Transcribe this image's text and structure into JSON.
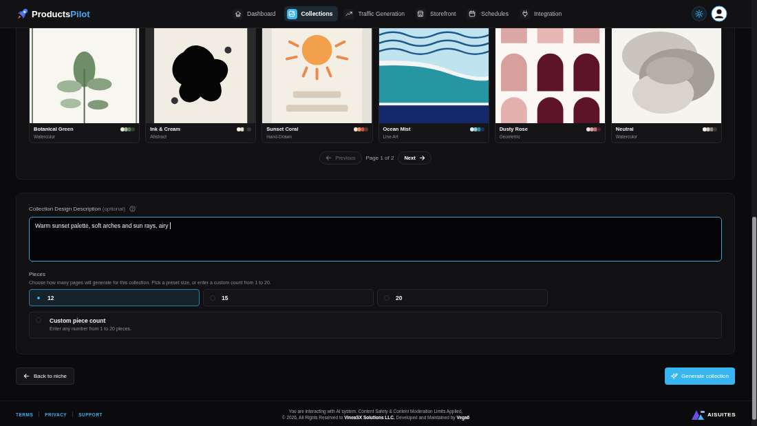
{
  "header": {
    "brand": {
      "name": "Products",
      "accent": "Pilot"
    },
    "nav": [
      {
        "label": "Dashboard",
        "selected": false
      },
      {
        "label": "Collections",
        "selected": true
      },
      {
        "label": "Traffic Generation",
        "selected": false
      },
      {
        "label": "Storefront",
        "selected": false
      },
      {
        "label": "Schedules",
        "selected": false
      },
      {
        "label": "Integration",
        "selected": false
      }
    ]
  },
  "styles": [
    {
      "name": "Botanical Green",
      "type": "Watercolor",
      "swatches": [
        {
          "color": "#e6ece3"
        },
        {
          "color": "#9db596"
        },
        {
          "color": "#5a7a54"
        },
        {
          "color": "#2f4430"
        }
      ]
    },
    {
      "name": "Ink & Cream",
      "type": "Abstract",
      "swatches": [
        {
          "color": "#f3efe4"
        },
        {
          "color": "#e2ddd0"
        },
        {
          "color": "#1c1c1c"
        },
        {
          "color": "#3a3a3a"
        }
      ]
    },
    {
      "name": "Sunset Coral",
      "type": "Hand-Drawn",
      "swatches": [
        {
          "color": "#f6e6d8"
        },
        {
          "color": "#f0905f"
        },
        {
          "color": "#c9553b"
        },
        {
          "color": "#5b3a2b"
        }
      ]
    },
    {
      "name": "Ocean Mist",
      "type": "Line Art",
      "swatches": [
        {
          "color": "#d6ecf0"
        },
        {
          "color": "#8cc6d0"
        },
        {
          "color": "#2b8fa0"
        },
        {
          "color": "#1d2f5c"
        }
      ]
    },
    {
      "name": "Dusty Rose",
      "type": "Geometric",
      "swatches": [
        {
          "color": "#f4e2df"
        },
        {
          "color": "#d7a29f"
        },
        {
          "color": "#b27474"
        },
        {
          "color": "#5c1a2c"
        }
      ]
    },
    {
      "name": "Neutral",
      "type": "Watercolor",
      "swatches": [
        {
          "color": "#f3f1ec"
        },
        {
          "color": "#cfcac2"
        },
        {
          "color": "#8a857e"
        },
        {
          "color": "#3a3836"
        }
      ]
    }
  ],
  "pagination": {
    "previous": {
      "label": "Previous",
      "disabled": true
    },
    "status": "Page 1 of 2",
    "next": {
      "label": "Next",
      "disabled": false
    }
  },
  "description": {
    "label": "Collection Design Description",
    "hint": "(optional)",
    "value": "Warm sunset palette, soft arches and sun rays, airy"
  },
  "pieces": {
    "title": "Pieces",
    "help": "Choose how many pages will generate for this collection. Pick a preset size, or enter a custom count from 1 to 20.",
    "options": [
      {
        "kind": "preset",
        "label": "12",
        "selected": true
      },
      {
        "kind": "preset",
        "label": "15",
        "selected": false
      },
      {
        "kind": "preset",
        "label": "20",
        "selected": false
      },
      {
        "kind": "custom",
        "label": "Custom piece count",
        "help": "Enter any number from 1 to 20 pieces.",
        "selected": false
      }
    ]
  },
  "actions": {
    "back": "Back to niche",
    "generate": "Generate collection"
  },
  "footer": {
    "links": [
      "TERMS",
      "PRIVACY",
      "SUPPORT"
    ],
    "notice": "You are interacting with AI system. Content Safety & Content Moderation Limits Applied.",
    "copyright": "© 2026, All Rights Reserved to **VineaSX Solutions LLC.** Developed and Maintained by **Vega6**",
    "logo": "AISUITES"
  }
}
